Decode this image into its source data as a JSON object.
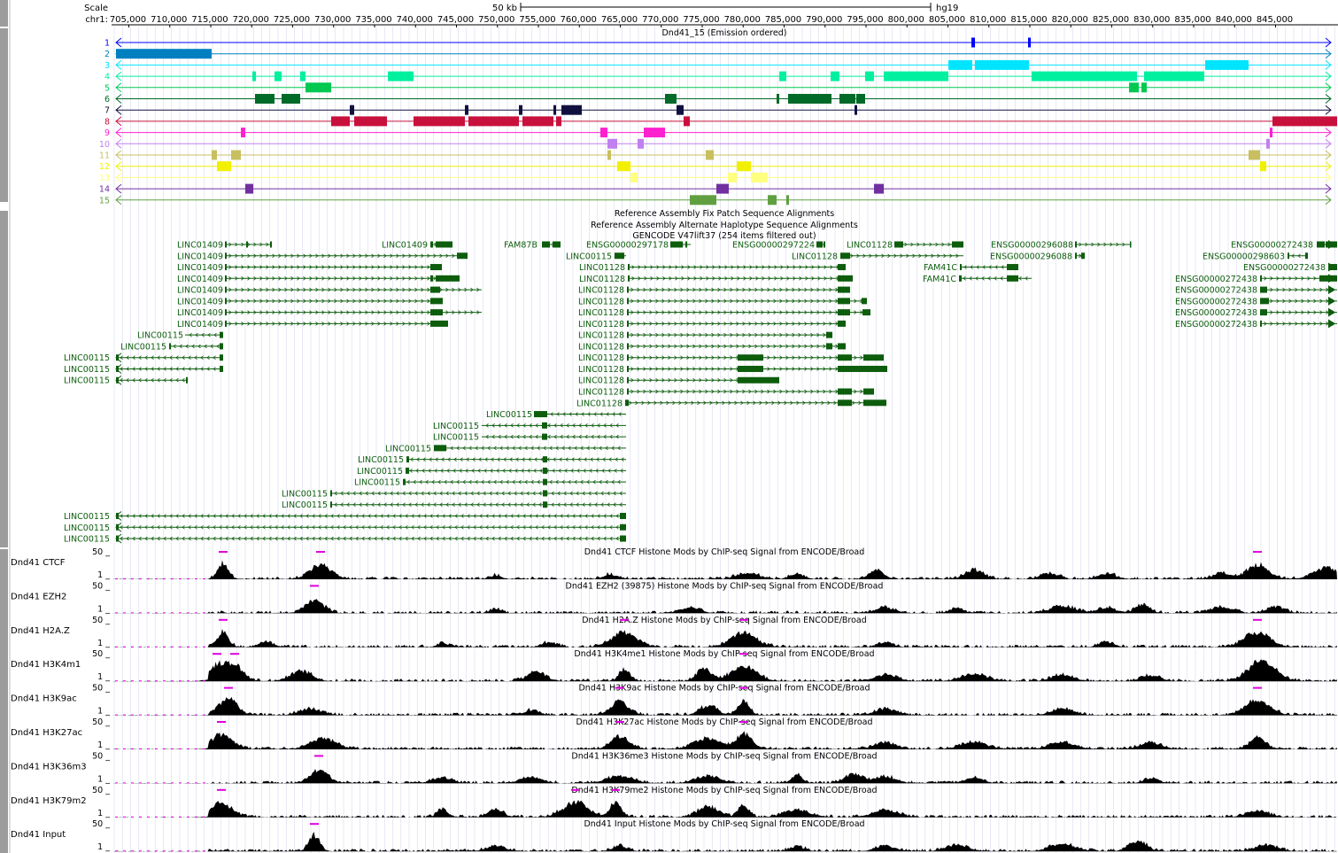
{
  "header": {
    "scale_label": "Scale",
    "chrom_label": "chr1:",
    "scale_bar_label": "50 kb",
    "assembly": "hg19",
    "tick_labels": [
      "705,000",
      "710,000",
      "715,000",
      "720,000",
      "725,000",
      "730,000",
      "735,000",
      "740,000",
      "745,000",
      "750,000",
      "755,000",
      "760,000",
      "765,000",
      "770,000",
      "775,000",
      "780,000",
      "785,000",
      "790,000",
      "795,000",
      "800,000",
      "805,000",
      "810,000",
      "815,000",
      "820,000",
      "825,000",
      "830,000",
      "835,000",
      "840,000",
      "845,000"
    ]
  },
  "chromhmm": {
    "title": "Dnd41_15 (Emission ordered)",
    "states": [
      {
        "num": "1",
        "color": "#0000ff"
      },
      {
        "num": "2",
        "color": "#0080c0"
      },
      {
        "num": "3",
        "color": "#00e5ff"
      },
      {
        "num": "4",
        "color": "#00f0a0"
      },
      {
        "num": "5",
        "color": "#00c850"
      },
      {
        "num": "6",
        "color": "#006a28"
      },
      {
        "num": "7",
        "color": "#101040"
      },
      {
        "num": "8",
        "color": "#c8103c"
      },
      {
        "num": "9",
        "color": "#ff20d0"
      },
      {
        "num": "10",
        "color": "#c080f0"
      },
      {
        "num": "11",
        "color": "#c8c060"
      },
      {
        "num": "12",
        "color": "#f0f000"
      },
      {
        "num": "13",
        "color": "#ffff80"
      },
      {
        "num": "14",
        "color": "#7030a0"
      },
      {
        "num": "15",
        "color": "#60a040"
      }
    ]
  },
  "fix_patch_title": "Reference Assembly Fix Patch Sequence Alignments",
  "alt_haplotype_title": "Reference Assembly Alternate Haplotype Sequence Alignments",
  "gencode": {
    "title": "GENCODE V47lift37 (254 items filtered out)",
    "gene_color": "#0d5d0d",
    "genes": [
      {
        "name": "LINC01409"
      },
      {
        "name": "LINC01409"
      },
      {
        "name": "FAM87B"
      },
      {
        "name": "ENSG00000297178"
      },
      {
        "name": "ENSG00000297224"
      },
      {
        "name": "LINC01128"
      },
      {
        "name": "ENSG00000296088"
      },
      {
        "name": "ENSG00000272438"
      },
      {
        "name": "LINC01409"
      },
      {
        "name": "LINC00115"
      },
      {
        "name": "LINC01128"
      },
      {
        "name": "ENSG00000296088"
      },
      {
        "name": "ENSG00000298603"
      },
      {
        "name": "LINC01409"
      },
      {
        "name": "LINC01128"
      },
      {
        "name": "FAM41C"
      },
      {
        "name": "ENSG00000272438"
      },
      {
        "name": "LINC01409"
      },
      {
        "name": "LINC01128"
      },
      {
        "name": "FAM41C"
      },
      {
        "name": "ENSG00000272438"
      },
      {
        "name": "LINC01409"
      },
      {
        "name": "LINC01128"
      },
      {
        "name": "ENSG00000272438"
      },
      {
        "name": "LINC01409"
      },
      {
        "name": "LINC01128"
      },
      {
        "name": "ENSG00000272438"
      },
      {
        "name": "LINC01409"
      },
      {
        "name": "LINC01128"
      },
      {
        "name": "ENSG00000272438"
      },
      {
        "name": "LINC01409"
      },
      {
        "name": "LINC01128"
      },
      {
        "name": "ENSG00000272438"
      },
      {
        "name": "LINC00115"
      },
      {
        "name": "LINC01128"
      },
      {
        "name": "LINC00115"
      },
      {
        "name": "LINC01128"
      },
      {
        "name": "LINC00115"
      },
      {
        "name": "LINC01128"
      },
      {
        "name": "LINC00115"
      },
      {
        "name": "LINC01128"
      },
      {
        "name": "LINC00115"
      },
      {
        "name": "LINC01128"
      },
      {
        "name": "LINC01128"
      },
      {
        "name": "LINC01128"
      },
      {
        "name": "LINC00115"
      },
      {
        "name": "LINC00115"
      },
      {
        "name": "LINC00115"
      },
      {
        "name": "LINC00115"
      },
      {
        "name": "LINC00115"
      },
      {
        "name": "LINC00115"
      },
      {
        "name": "LINC00115"
      },
      {
        "name": "LINC00115"
      },
      {
        "name": "LINC00115"
      },
      {
        "name": "LINC00115"
      },
      {
        "name": "LINC00115"
      },
      {
        "name": "LINC00115"
      }
    ]
  },
  "signal_tracks": [
    {
      "label": "Dnd41 CTCF",
      "title": "Dnd41 CTCF Histone Mods by ChIP-seq Signal from ENCODE/Broad",
      "max": "50 _",
      "min": "1 _"
    },
    {
      "label": "Dnd41 EZH2",
      "title": "Dnd41 EZH2 (39875) Histone Mods by ChIP-seq Signal from ENCODE/Broad",
      "max": "50 _",
      "min": "1 _"
    },
    {
      "label": "Dnd41 H2A.Z",
      "title": "Dnd41 H2A.Z Histone Mods by ChIP-seq Signal from ENCODE/Broad",
      "max": "50 _",
      "min": "1 _"
    },
    {
      "label": "Dnd41 H3K4m1",
      "title": "Dnd41 H3K4me1 Histone Mods by ChIP-seq Signal from ENCODE/Broad",
      "max": "50 _",
      "min": "1 _"
    },
    {
      "label": "Dnd41 H3K9ac",
      "title": "Dnd41 H3K9ac Histone Mods by ChIP-seq Signal from ENCODE/Broad",
      "max": "50 _",
      "min": "1 _"
    },
    {
      "label": "Dnd41 H3K27ac",
      "title": "Dnd41 H3K27ac Histone Mods by ChIP-seq Signal from ENCODE/Broad",
      "max": "50 _",
      "min": "1 _"
    },
    {
      "label": "Dnd41 H3K36m3",
      "title": "Dnd41 H3K36me3 Histone Mods by ChIP-seq Signal from ENCODE/Broad",
      "max": "50 _",
      "min": "1 _"
    },
    {
      "label": "Dnd41 H3K79m2",
      "title": "Dnd41 H3K79me2 Histone Mods by ChIP-seq Signal from ENCODE/Broad",
      "max": "50 _",
      "min": "1 _"
    },
    {
      "label": "Dnd41 Input",
      "title": "Dnd41 Input Histone Mods by ChIP-seq Signal from ENCODE/Broad",
      "max": "50 _",
      "min": "1 _"
    }
  ],
  "colors": {
    "grid": "#d8d8f0",
    "fix_patch": "#a08040",
    "alt_haplotype": "#202080",
    "signal": "#000000",
    "clip": "#e000e0",
    "left_bar": "#9c9c9c"
  }
}
